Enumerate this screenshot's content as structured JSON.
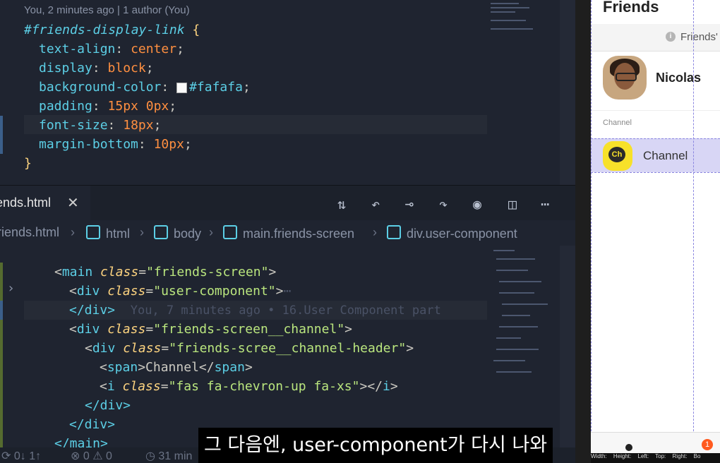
{
  "colors": {
    "editor_bg": "#1f2430",
    "accent": "#4fb6e0",
    "tag": "#5ccfe6",
    "string": "#bae67e",
    "attr": "#ffd580",
    "number": "#ff8f40"
  },
  "blame_top": "You, 2 minutes ago | 1 author (You)",
  "css": {
    "selector": "#friends-display-link",
    "open_brace": "{",
    "close_brace": "}",
    "lines": [
      {
        "prop": "text-align",
        "value": "center"
      },
      {
        "prop": "display",
        "value": "block"
      },
      {
        "prop": "background-color",
        "value": "#fafafa"
      },
      {
        "prop": "padding",
        "value": "15px 0px"
      },
      {
        "prop": "font-size",
        "value": "18px"
      },
      {
        "prop": "margin-bottom",
        "value": "10px"
      }
    ]
  },
  "tab": {
    "label": "ends.html",
    "close": "✕"
  },
  "toolbar_icons": [
    "compare-changes-icon",
    "go-back-icon",
    "commit-icon",
    "go-forward-icon",
    "git-lens-icon",
    "split-editor-icon",
    "more-actions-icon"
  ],
  "breadcrumb": {
    "file": "riends.html",
    "items": [
      "html",
      "body",
      "main.friends-screen",
      "div.user-component"
    ]
  },
  "html_code": {
    "l1_tag": "main",
    "l1_attr": "class",
    "l1_val": "\"friends-screen\"",
    "l2_tag": "div",
    "l2_attr": "class",
    "l2_val": "\"user-component\"",
    "l2_fold": "⋯",
    "l3_close": "</div>",
    "inline_blame": "You, 7 minutes ago • 16.User Component part",
    "l4_tag": "div",
    "l4_attr": "class",
    "l4_val": "\"friends-screen__channel\"",
    "l5_tag": "div",
    "l5_attr": "class",
    "l5_val": "\"friends-scree__channel-header\"",
    "l6_open": "span",
    "l6_text": "Channel",
    "l6_close": "span",
    "l7_tag": "i",
    "l7_attr": "class",
    "l7_val": "\"fas fa-chevron-up fa-xs\"",
    "l7_close": "i",
    "l8_close": "</div>",
    "l9_close": "</div>",
    "l10_close": "</main>"
  },
  "status": {
    "sync": "⟳ 0↓ 1↑",
    "problems": "⊗ 0 ⚠ 0",
    "time": "◷ 31 min"
  },
  "subtitle": "그 다음엔, user-component가 다시 나와",
  "preview": {
    "title": "Friends",
    "friends_bar": "Friends'",
    "info_icon": "i",
    "user_name": "Nicolas",
    "channel_header": "Channel",
    "channel_label": "Channel",
    "channel_icon_text": "Ch",
    "badge": "1",
    "measure": [
      "Width:",
      "Height:",
      "Left:",
      "Top:",
      "Right:",
      "Bo"
    ]
  }
}
